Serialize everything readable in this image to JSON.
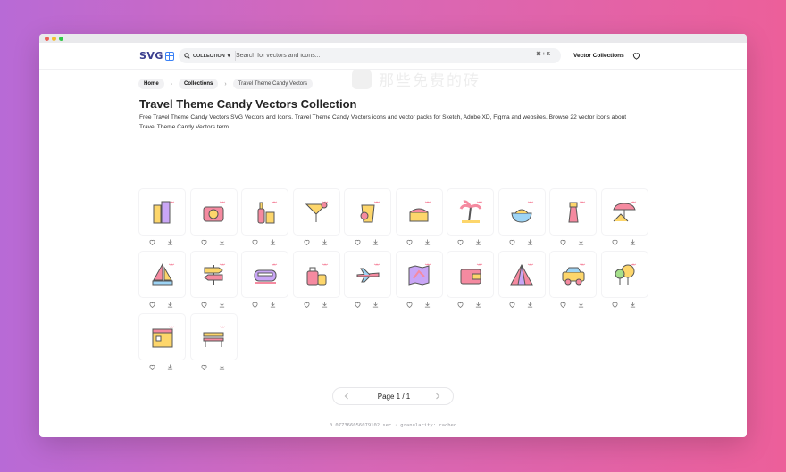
{
  "header": {
    "logo_text": "SVG",
    "collection_label": "COLLECTION",
    "search_placeholder": "Search for vectors and icons...",
    "shortcut": "⌘ + K",
    "nav_link": "Vector Collections",
    "watermark": "那些免费的砖"
  },
  "breadcrumb": [
    "Home",
    "Collections",
    "Travel Theme Candy Vectors"
  ],
  "page": {
    "title": "Travel Theme Candy Vectors Collection",
    "description": "Free Travel Theme Candy Vectors SVG Vectors and Icons. Travel Theme Candy Vectors icons and vector packs for Sketch, Adobe XD, Figma and websites. Browse 22 vector icons about Travel Theme Candy Vectors term."
  },
  "icons": [
    {
      "name": "buildings-icon",
      "colors": [
        "#fdd66b",
        "#c9a6f6"
      ]
    },
    {
      "name": "camera-bag-icon",
      "colors": [
        "#f58aa0",
        "#fdd66b"
      ]
    },
    {
      "name": "wine-bottle-icon",
      "colors": [
        "#f58aa0",
        "#fdd66b"
      ]
    },
    {
      "name": "cocktail-icon",
      "colors": [
        "#fdd66b",
        "#f58aa0"
      ]
    },
    {
      "name": "coffee-cup-icon",
      "colors": [
        "#fdd66b",
        "#f58aa0"
      ]
    },
    {
      "name": "cake-icon",
      "colors": [
        "#fdd66b",
        "#f58aa0"
      ]
    },
    {
      "name": "palm-tree-icon",
      "colors": [
        "#f58aa0",
        "#fdd66b"
      ]
    },
    {
      "name": "food-bowl-icon",
      "colors": [
        "#9dd4f5",
        "#fdd66b"
      ]
    },
    {
      "name": "lighthouse-icon",
      "colors": [
        "#f58aa0",
        "#fdd66b"
      ]
    },
    {
      "name": "beach-chair-icon",
      "colors": [
        "#f58aa0",
        "#fdd66b"
      ]
    },
    {
      "name": "sailboat-icon",
      "colors": [
        "#f58aa0",
        "#fdd66b"
      ]
    },
    {
      "name": "signpost-icon",
      "colors": [
        "#fdd66b",
        "#f58aa0"
      ]
    },
    {
      "name": "train-icon",
      "colors": [
        "#c9a6f6",
        "#f58aa0"
      ]
    },
    {
      "name": "luggage-icon",
      "colors": [
        "#f58aa0",
        "#fdd66b"
      ]
    },
    {
      "name": "airplane-icon",
      "colors": [
        "#f58aa0",
        "#9dd4f5"
      ]
    },
    {
      "name": "map-icon",
      "colors": [
        "#c9a6f6",
        "#f58aa0"
      ]
    },
    {
      "name": "wallet-icon",
      "colors": [
        "#f58aa0",
        "#fdd66b"
      ]
    },
    {
      "name": "pyramid-icon",
      "colors": [
        "#f58aa0",
        "#c9a6f6"
      ]
    },
    {
      "name": "car-icon",
      "colors": [
        "#fdd66b",
        "#f58aa0"
      ]
    },
    {
      "name": "trees-icon",
      "colors": [
        "#a5e08a",
        "#fdd66b"
      ]
    },
    {
      "name": "hotel-icon",
      "colors": [
        "#fdd66b",
        "#f58aa0"
      ]
    },
    {
      "name": "bench-icon",
      "colors": [
        "#f58aa0",
        "#fdd66b"
      ]
    }
  ],
  "pagination": {
    "label": "Page 1 / 1"
  },
  "footer": {
    "text": "0.077366056079102 sec · granularity: cached"
  }
}
